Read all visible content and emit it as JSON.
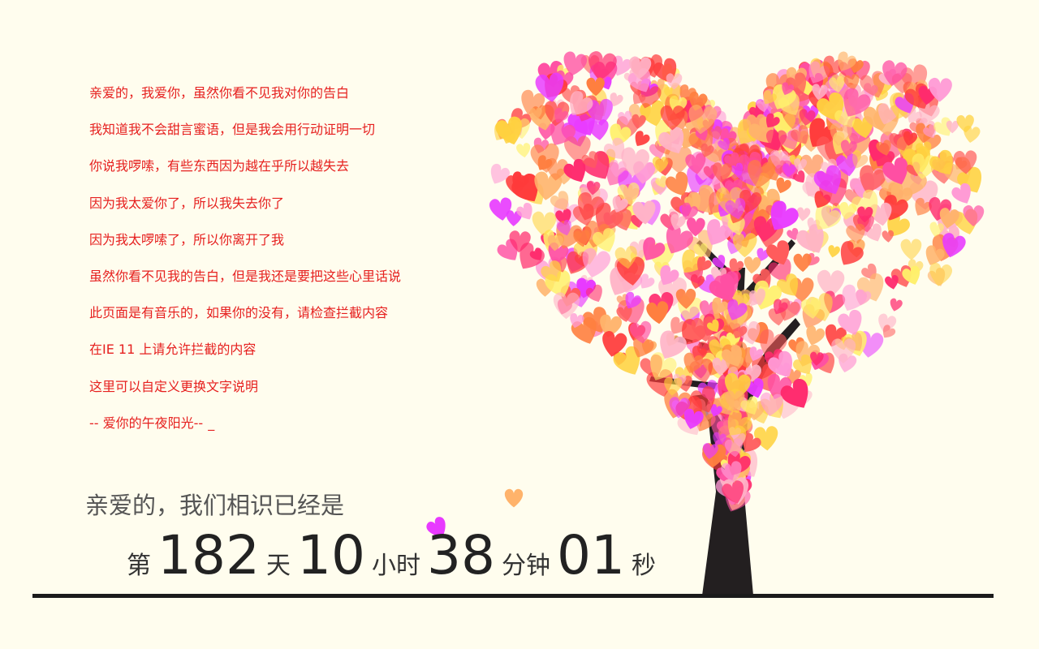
{
  "poem": {
    "lines": [
      "亲爱的，我爱你，虽然你看不见我对你的告白",
      "我知道我不会甜言蜜语，但是我会用行动证明一切",
      "你说我啰嗦，有些东西因为越在乎所以越失去",
      "因为我太爱你了，所以我失去你了",
      "因为我太啰嗦了，所以你离开了我",
      "虽然你看不见我的告白，但是我还是要把这些心里话说",
      "此页面是有音乐的，如果你的没有，请检查拦截内容",
      "在IE 11 上请允许拦截的内容",
      "这里可以自定义更换文字说明",
      "-- 爱你的午夜阳光--"
    ],
    "cursor": "_"
  },
  "counter": {
    "title": "亲爱的，我们相识已经是",
    "prefix": "第",
    "days": "182",
    "days_unit": "天",
    "hours": "10",
    "hours_unit": "小时",
    "minutes": "38",
    "minutes_unit": "分钟",
    "seconds": "01",
    "seconds_unit": "秒"
  },
  "colors": {
    "background": "#fffdee",
    "poem_text": "#e6201f",
    "trunk": "#231f20",
    "heart_palette": [
      "#ff2a6d",
      "#ff4fa3",
      "#ff7f3f",
      "#ffd23f",
      "#ff9ad5",
      "#e83aff",
      "#ff5c5c",
      "#ffb36b",
      "#fff06a",
      "#ff3b3b",
      "#ffb3c7"
    ]
  }
}
